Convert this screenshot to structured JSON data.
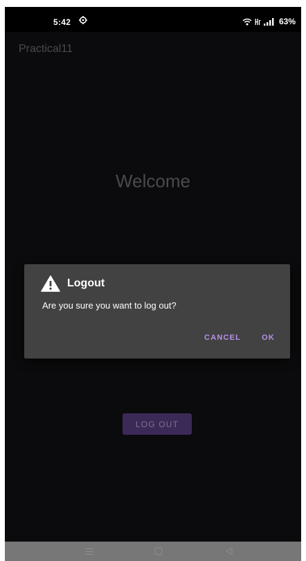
{
  "status_bar": {
    "time": "5:42",
    "battery": "63%",
    "icons": [
      "settings-icon",
      "wifi-icon",
      "hd-icon",
      "signal-icon"
    ]
  },
  "app": {
    "title": "Practical11",
    "welcome": "Welcome",
    "logout_button": "LOG OUT"
  },
  "dialog": {
    "icon": "warning-icon",
    "title": "Logout",
    "message": "Are you sure you want to log out?",
    "cancel": "CANCEL",
    "ok": "OK"
  },
  "nav_bar": {
    "icons": [
      "menu-icon",
      "home-icon",
      "back-icon"
    ]
  },
  "colors": {
    "background": "#0b0a0c",
    "dialog": "#424242",
    "accent": "#b891e6",
    "button": "#3b2a57"
  }
}
